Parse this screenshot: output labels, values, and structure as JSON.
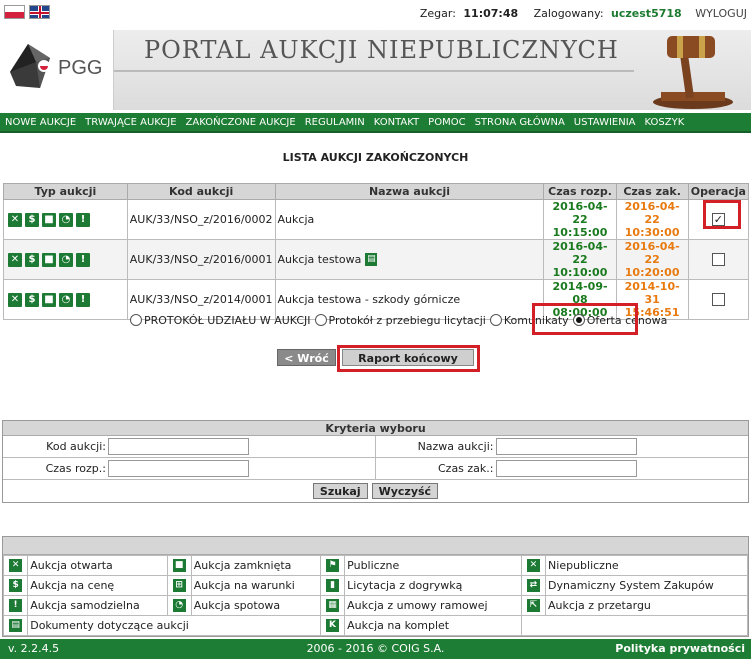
{
  "topbar": {
    "clock_label": "Zegar:",
    "clock_value": "11:07:48",
    "logged_label": "Zalogowany:",
    "username": "uczest5718",
    "logout": "WYLOGUJ"
  },
  "header": {
    "logo_text": "PGG",
    "portal_title": "PORTAL AUKCJI NIEPUBLICZNYCH"
  },
  "nav": [
    "NOWE AUKCJE",
    "TRWAJĄCE AUKCJE",
    "ZAKOŃCZONE AUKCJE",
    "REGULAMIN",
    "KONTAKT",
    "POMOC",
    "STRONA GŁÓWNA",
    "USTAWIENIA",
    "KOSZYK"
  ],
  "page_title": "LISTA AUKCJI ZAKOŃCZONYCH",
  "table": {
    "headers": [
      "Typ aukcji",
      "Kod aukcji",
      "Nazwa aukcji",
      "Czas rozp.",
      "Czas zak.",
      "Operacja"
    ],
    "rows": [
      {
        "code": "AUK/33/NSO_z/2016/0002",
        "name": "Aukcja",
        "start_date": "2016-04-22",
        "start_time": "10:15:00",
        "end_date": "2016-04-22",
        "end_time": "10:30:00",
        "checked": true,
        "has_doc": false
      },
      {
        "code": "AUK/33/NSO_z/2016/0001",
        "name": "Aukcja testowa",
        "start_date": "2016-04-22",
        "start_time": "10:10:00",
        "end_date": "2016-04-22",
        "end_time": "10:20:00",
        "checked": false,
        "has_doc": true
      },
      {
        "code": "AUK/33/NSO_z/2014/0001",
        "name": "Aukcja testowa - szkody górnicze",
        "start_date": "2014-09-08",
        "start_time": "08:00:00",
        "end_date": "2014-10-31",
        "end_time": "15:46:51",
        "checked": false,
        "has_doc": false
      }
    ]
  },
  "report_options": {
    "options": [
      "PROTOKÓŁ UDZIAŁU W AUKCJI",
      "Protokół z przebiegu licytacji",
      "Komunikaty",
      "Oferta cenowa"
    ],
    "selected_index": 3
  },
  "buttons": {
    "back": "< Wróć",
    "report": "Raport końcowy"
  },
  "criteria": {
    "title": "Kryteria wyboru",
    "code_label": "Kod aukcji:",
    "name_label": "Nazwa aukcji:",
    "start_label": "Czas rozp.:",
    "end_label": "Czas zak.:",
    "code_value": "",
    "name_value": "",
    "start_value": "",
    "end_value": "",
    "search": "Szukaj",
    "clear": "Wyczyść"
  },
  "legend": [
    [
      "Aukcja otwarta",
      "Aukcja zamknięta",
      "Publiczne",
      "Niepubliczne"
    ],
    [
      "Aukcja na cenę",
      "Aukcja na warunki",
      "Licytacja z dogrywką",
      "Dynamiczny System Zakupów"
    ],
    [
      "Aukcja samodzielna",
      "Aukcja spotowa",
      "Aukcja z umowy ramowej",
      "Aukcja z przetargu"
    ],
    [
      "Dokumenty dotyczące aukcji",
      "",
      "Aukcja na komplet",
      ""
    ]
  ],
  "footer": {
    "version": "v. 2.2.4.5",
    "copyright": "2006 - 2016 © COIG S.A.",
    "privacy": "Polityka prywatności"
  },
  "colors": {
    "brand_green": "#1e7d34",
    "date_green": "#1a7a1e",
    "date_orange": "#e87a10",
    "highlight_red": "#d31f26"
  }
}
